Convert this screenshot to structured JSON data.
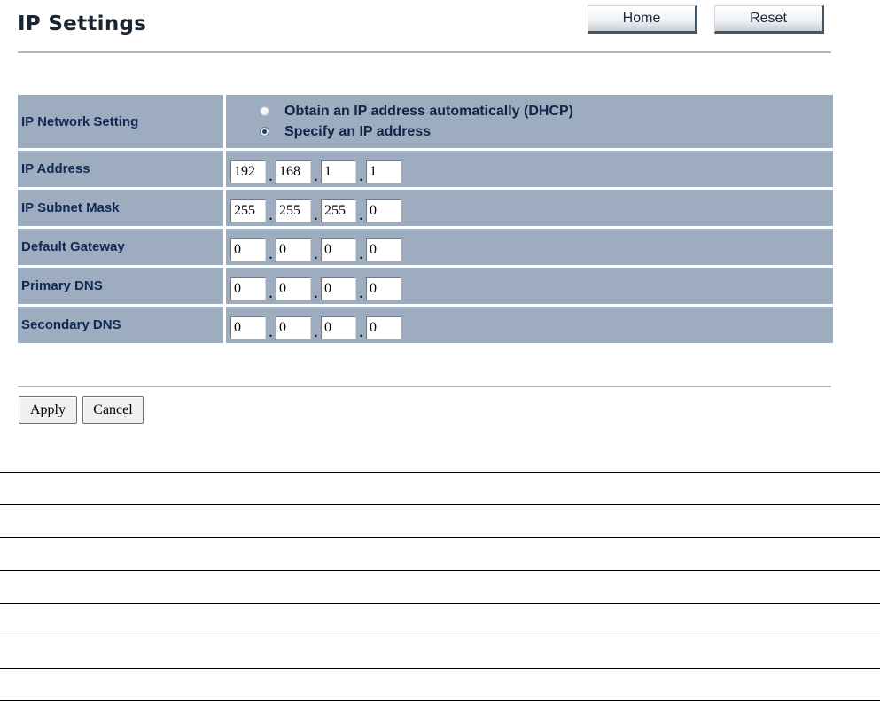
{
  "header": {
    "title": "IP Settings",
    "home_label": "Home",
    "reset_label": "Reset"
  },
  "form": {
    "rows": {
      "network_setting": {
        "label": "IP Network Setting",
        "options": [
          {
            "label": "Obtain an IP address automatically (DHCP)",
            "checked": false
          },
          {
            "label": "Specify an IP address",
            "checked": true
          }
        ]
      },
      "ip_address": {
        "label": "IP Address",
        "octets": [
          "192",
          "168",
          "1",
          "1"
        ]
      },
      "subnet_mask": {
        "label": "IP Subnet Mask",
        "octets": [
          "255",
          "255",
          "255",
          "0"
        ]
      },
      "default_gateway": {
        "label": "Default Gateway",
        "octets": [
          "0",
          "0",
          "0",
          "0"
        ]
      },
      "primary_dns": {
        "label": "Primary DNS",
        "octets": [
          "0",
          "0",
          "0",
          "0"
        ]
      },
      "secondary_dns": {
        "label": "Secondary DNS",
        "octets": [
          "0",
          "0",
          "0",
          "0"
        ]
      }
    },
    "separator": ".",
    "apply_label": "Apply",
    "cancel_label": "Cancel"
  },
  "colors": {
    "table_background": "#9eacc0",
    "label_text": "#102a55",
    "rule": "#aab6c3"
  }
}
